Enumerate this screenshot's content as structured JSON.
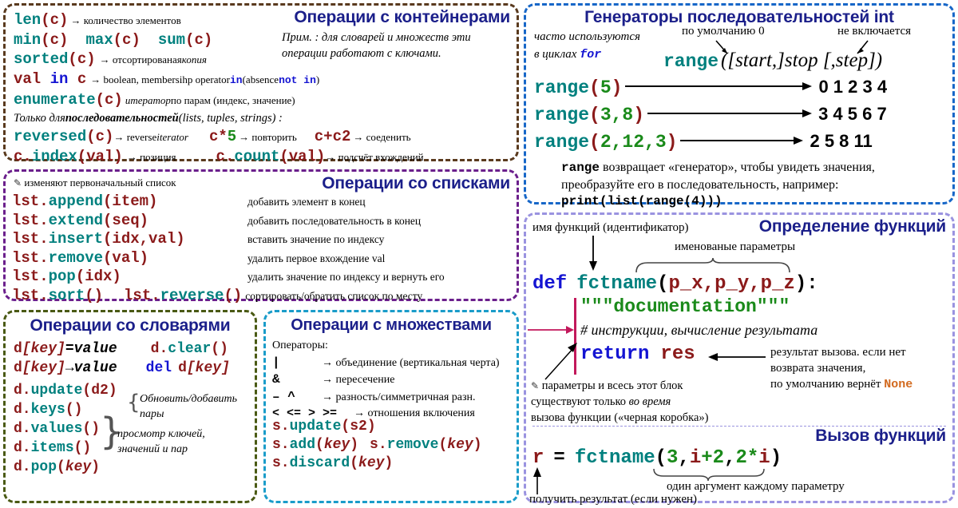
{
  "sheet": {
    "colors": {
      "title": "#1b1f8a",
      "function_name": "#00807e",
      "argument": "#8b1a1a",
      "keyword": "#1414d2",
      "number": "#1a8a1a",
      "none_literal": "#d2691e",
      "border_containers": "#5a3a1e",
      "border_lists": "#6b1f8c",
      "border_dicts": "#4a5a14",
      "border_sets": "#1a9cc9",
      "border_range": "#1767c8",
      "border_functions": "#9a93e0"
    }
  },
  "containers": {
    "title": "Операции с контейнерами",
    "note_line1": "Прим. : для словарей и множеств эти",
    "note_line2": "операции работают с ключами.",
    "rows": {
      "len_fn": "len",
      "len_arg": "(c)",
      "len_desc": "→ количество элементов",
      "min_fn": "min",
      "min_arg": "(c)",
      "max_fn": "max",
      "max_arg": "(c)",
      "sum_fn": "sum",
      "sum_arg": "(c)",
      "sorted_fn": "sorted",
      "sorted_arg": "(c)",
      "sorted_desc_plain": "→ отсортированая ",
      "sorted_desc_it": "копия",
      "val_in": "val in c",
      "val_desc_a": "→ boolean, membersihp operator ",
      "val_in_kw": "in",
      "val_desc_b": " (absence ",
      "val_notin_kw": "not in",
      "val_desc_c": ")",
      "enumerate_fn": "enumerate",
      "enumerate_arg": "(c)",
      "enumerate_desc_it": "итератор",
      "enumerate_desc": " по парам (индекс, значение)",
      "seq_note_a": "Только для ",
      "seq_note_b": "последовательностей",
      "seq_note_c": " (lists, tuples, strings) :",
      "reversed_fn": "reversed",
      "reversed_arg": "(c)",
      "reversed_desc": "→ reverse ",
      "reversed_desc_it": "iterator",
      "repeat_code": "c*5",
      "repeat_desc": "→ повторить",
      "concat_code": "c+c2",
      "concat_desc": "→ соеденить",
      "index_obj": "c.",
      "index_fn": "index",
      "index_arg": "(val)",
      "index_desc": "→ позиция",
      "count_obj": "c.",
      "count_fn": "count",
      "count_arg": "(val)",
      "count_desc": "→ подсчёт вхождений"
    }
  },
  "lists": {
    "title": "Операции со списками",
    "modify_note": "изменяют первоначальный список",
    "items": [
      {
        "obj": "lst.",
        "fn": "append",
        "arg": "(item)",
        "desc": "добавить элемент в конец"
      },
      {
        "obj": "lst.",
        "fn": "extend",
        "arg": "(seq)",
        "desc": "добавить последовательность в конец"
      },
      {
        "obj": "lst.",
        "fn": "insert",
        "arg": "(idx,val)",
        "desc": "вставить значение по индексу"
      },
      {
        "obj": "lst.",
        "fn": "remove",
        "arg": "(val)",
        "desc": "удалить первое вхождение val"
      },
      {
        "obj": "lst.",
        "fn": "pop",
        "arg": "(idx)",
        "desc": "удалить значение по индексу и вернуть его"
      }
    ],
    "last_row": {
      "sort_obj": "lst.",
      "sort_fn": "sort",
      "sort_arg": "()",
      "rev_obj": "lst.",
      "rev_fn": "reverse",
      "rev_arg": "()",
      "desc": "сортировать/обратить список по месту"
    }
  },
  "dicts": {
    "title": "Операции со словарями",
    "set_item": {
      "obj": "d",
      "key": "[key]",
      "eq": "=",
      "value": "value"
    },
    "get_item": {
      "obj": "d",
      "key": "[key]",
      "arrow": "→",
      "value": "value"
    },
    "clear": {
      "obj": "d.",
      "fn": "clear",
      "arg": "()"
    },
    "del": {
      "kw": "del",
      "obj": "d",
      "key": "[key]"
    },
    "update": {
      "obj": "d.",
      "fn": "update",
      "arg": "(d2)"
    },
    "update_note_l1": "Обновить/добавить",
    "update_note_l2": "пары",
    "keys": {
      "obj": "d.",
      "fn": "keys",
      "arg": "()"
    },
    "values": {
      "obj": "d.",
      "fn": "values",
      "arg": "()"
    },
    "items": {
      "obj": "d.",
      "fn": "items",
      "arg": "()"
    },
    "view_note_l1": "просмотр ключей,",
    "view_note_l2": "значений и пар",
    "pop": {
      "obj": "d.",
      "fn": "pop",
      "arg": "(",
      "key": "key",
      "argend": ")"
    }
  },
  "sets": {
    "title": "Операции с множествами",
    "operators_label": "Операторы:",
    "operators": [
      {
        "sym": "|",
        "desc": "→ объединение (вертикальная черта)"
      },
      {
        "sym": "&",
        "desc": "→ пересечение"
      },
      {
        "sym": "–  ^",
        "desc": "→ разность/симметричная разн."
      },
      {
        "sym": "<  <=  >  >=",
        "desc": "→ отношения включения"
      }
    ],
    "update": {
      "obj": "s.",
      "fn": "update",
      "arg": "(s2)"
    },
    "add": {
      "obj": "s.",
      "fn": "add",
      "arg_open": "(",
      "key": "key",
      "arg_close": ")"
    },
    "remove": {
      "obj": "s.",
      "fn": "remove",
      "arg_open": "(",
      "key": "key",
      "arg_close": ")"
    },
    "discard": {
      "obj": "s.",
      "fn": "discard",
      "arg_open": "(",
      "key": "key",
      "arg_close": ")"
    }
  },
  "range": {
    "title": "Генераторы последовательностей int",
    "used_note_l1": "часто используются",
    "used_note_l2_a": "в циклах ",
    "used_note_l2_kw": "for",
    "default_label": "по умолчанию 0",
    "exclusive_label": "не включается",
    "signature_fn": "range",
    "signature_args": "([start,]stop [,step])",
    "examples": [
      {
        "fn": "range",
        "open": "(",
        "args": "5",
        "close": ")",
        "result": "0  1  2  3  4"
      },
      {
        "fn": "range",
        "open": "(",
        "args": "3,8",
        "close": ")",
        "result": "3  4  5  6  7"
      },
      {
        "fn": "range",
        "open": "(",
        "args": "2,12,3",
        "close": ")",
        "result": "2  5  8  11"
      }
    ],
    "footnote_kw": "range",
    "footnote_l1": " возвращает «генератор», чтобы увидеть значения,",
    "footnote_l2": "преобразуйте его в последовательность, например:",
    "footnote_code": "print(list(range(4)))"
  },
  "funcdef": {
    "title": "Определение функций",
    "fname_label": "имя функций (идентификатор)",
    "named_params_label": "именованые параметры",
    "def_kw": "def",
    "def_name": "fctname",
    "def_open": "(",
    "def_params": "p_x,p_y,p_z",
    "def_close": "):",
    "docstring": "\"\"\"documentation\"\"\"",
    "comment": "# инструкции, вычисление результата",
    "return_kw": "return",
    "return_val": "res",
    "return_note_l1": "результат вызова. если нет",
    "return_note_l2": "возврата значения,",
    "return_note_l3_a": "по умолчанию вернёт ",
    "return_note_l3_none": "None",
    "scope_note_l1": "параметры и всесь этот блок",
    "scope_note_l2_a": "существуют только ",
    "scope_note_l2_it": "во время",
    "scope_note_l3": "вызова функции («черная коробка»)"
  },
  "funccall": {
    "title": "Вызов функций",
    "result_var": "r",
    "assign": "=",
    "fn": "fctname",
    "open": "(",
    "arg1": "3",
    "comma1": ",",
    "arg2": "i",
    "plus": "+2",
    "comma2": ",",
    "arg3a": "2*",
    "arg3b": "i",
    "close": ")",
    "args_note": "один аргумент каждому параметру",
    "result_note": "получить результат (если нужен)"
  }
}
